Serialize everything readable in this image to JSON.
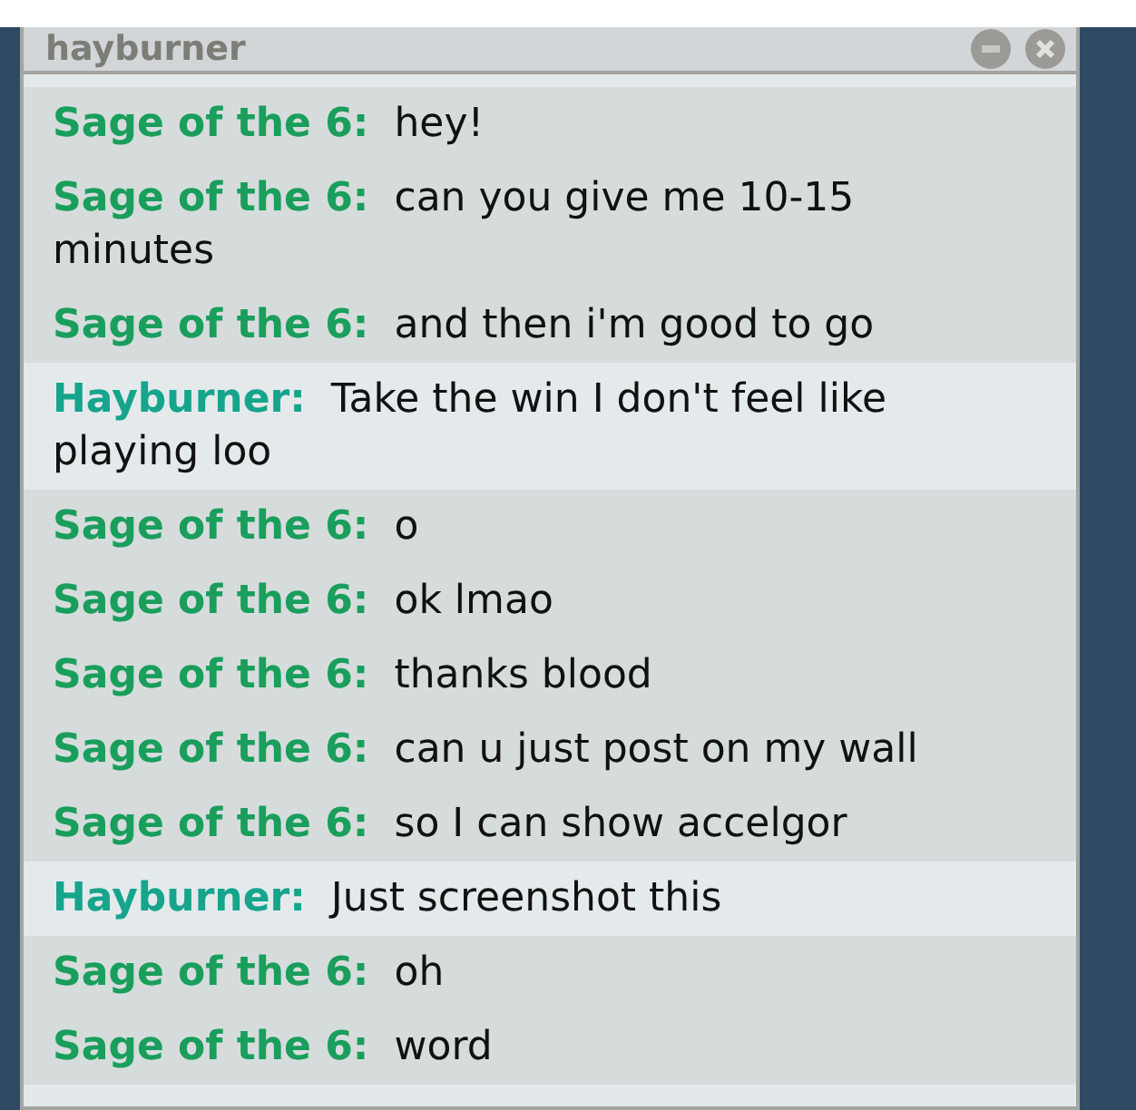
{
  "window": {
    "title": "hayburner"
  },
  "messages": [
    {
      "sender": "Sage of the 6:",
      "text": "hey!",
      "color": "#1a9e5c",
      "highlighted": false
    },
    {
      "sender": "Sage of the 6:",
      "text": "can you give me 10-15 minutes",
      "color": "#1a9e5c",
      "highlighted": false
    },
    {
      "sender": "Sage of the 6:",
      "text": "and then i'm good to go",
      "color": "#1a9e5c",
      "highlighted": false
    },
    {
      "sender": "Hayburner:",
      "text": "Take the win I don't feel like playing loo",
      "color": "#16a58c",
      "highlighted": true
    },
    {
      "sender": "Sage of the 6:",
      "text": "o",
      "color": "#1a9e5c",
      "highlighted": false
    },
    {
      "sender": "Sage of the 6:",
      "text": "ok lmao",
      "color": "#1a9e5c",
      "highlighted": false
    },
    {
      "sender": "Sage of the 6:",
      "text": "thanks blood",
      "color": "#1a9e5c",
      "highlighted": false
    },
    {
      "sender": "Sage of the 6:",
      "text": "can u just post on my wall",
      "color": "#1a9e5c",
      "highlighted": false
    },
    {
      "sender": "Sage of the 6:",
      "text": "so I can show accelgor",
      "color": "#1a9e5c",
      "highlighted": false
    },
    {
      "sender": "Hayburner:",
      "text": "Just screenshot this",
      "color": "#16a58c",
      "highlighted": true
    },
    {
      "sender": "Sage of the 6:",
      "text": "oh",
      "color": "#1a9e5c",
      "highlighted": false
    },
    {
      "sender": "Sage of the 6:",
      "text": "word",
      "color": "#1a9e5c",
      "highlighted": false
    }
  ]
}
